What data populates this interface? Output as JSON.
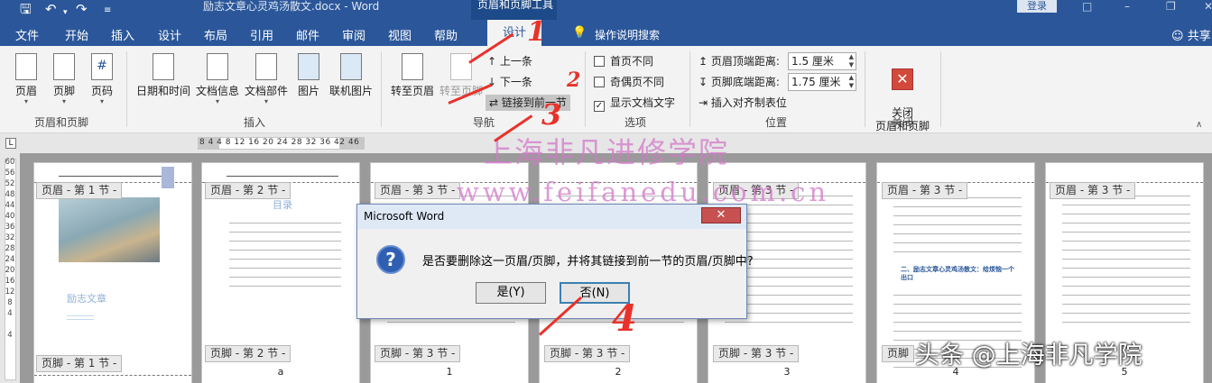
{
  "title_bar": {
    "doc_title": "励志文章心灵鸡汤散文.docx  -  Word",
    "context_group": "页眉和页脚工具",
    "login": "登录",
    "save_icon": "save-icon",
    "undo_icon": "undo-icon",
    "redo_icon": "redo-icon"
  },
  "tabs": [
    "文件",
    "开始",
    "插入",
    "设计",
    "布局",
    "引用",
    "邮件",
    "审阅",
    "视图",
    "帮助"
  ],
  "active_tab": "设计",
  "tell_me": "操作说明搜索",
  "share": "共享",
  "ribbon": {
    "hf_group": {
      "label": "页眉和页脚",
      "header": "页眉",
      "footer": "页脚",
      "page_number": "页码"
    },
    "insert_group": {
      "label": "插入",
      "datetime": "日期和时间",
      "docinfo": "文档信息",
      "quickparts": "文档部件",
      "picture": "图片",
      "online_picture": "联机图片"
    },
    "nav_group": {
      "label": "导航",
      "goto_header": "转至页眉",
      "goto_footer": "转至页脚",
      "prev": "上一条",
      "next": "下一条",
      "link_prev": "链接到前一节"
    },
    "options_group": {
      "label": "选项",
      "diff_first": "首页不同",
      "diff_odd_even": "奇偶页不同",
      "show_doc_text": "显示文档文字"
    },
    "position_group": {
      "label": "位置",
      "header_top_label": "页眉顶端距离:",
      "header_top_value": "1.5 厘米",
      "footer_bottom_label": "页脚底端距离:",
      "footer_bottom_value": "1.75 厘米",
      "insert_align_tab": "插入对齐制表位"
    },
    "close_group": {
      "label": "关闭",
      "close_btn": "关闭\n页眉和页脚"
    }
  },
  "ruler": {
    "corner": "L",
    "h_text": "8 4   4  8 12 16 20 24 28 32 36  42 46",
    "v_text": "60\n56\n52\n48\n44\n40\n36\n32\n28\n24\n20\n16\n12\n8\n4\n\n4"
  },
  "pages": [
    {
      "header": "页眉 - 第 1 节 -",
      "footer": "页脚 - 第 1 节 -",
      "title": "励志文章",
      "num": ""
    },
    {
      "header": "页眉 - 第 2 节 -",
      "footer": "页脚 - 第 2 节 -",
      "title": "目录",
      "num": "a"
    },
    {
      "header": "页眉 - 第 3 节 -",
      "footer": "页脚 - 第 3 节 -",
      "title": "",
      "num": "1"
    },
    {
      "header": "",
      "footer": "页脚 - 第 3 节 -",
      "title": "",
      "num": "2"
    },
    {
      "header": "页眉 - 第 3 节 -",
      "footer": "页脚 - 第 3 节 -",
      "title": "",
      "num": "3"
    },
    {
      "header": "页眉 - 第 3 节 -",
      "footer": "页脚",
      "title": "二、励志文章心灵鸡汤散文：给烦恼一个出口",
      "num": "4"
    },
    {
      "header": "页眉 - 第 3 节 -",
      "footer": "",
      "title": "",
      "num": "5"
    }
  ],
  "watermark": {
    "line1": "上海非凡进修学院",
    "line2": "www.feifanedu.com.cn"
  },
  "dialog": {
    "title": "Microsoft Word",
    "close": "✕",
    "message": "是否要删除这一页眉/页脚，并将其链接到前一节的页眉/页脚中?",
    "yes": "是(Y)",
    "no": "否(N)"
  },
  "annotations": [
    "1",
    "2",
    "3",
    "4"
  ],
  "brand": "头条 @上海非凡学院",
  "colors": {
    "word_blue": "#2b579a",
    "annotation_red": "#e8322b",
    "watermark_pink": "#d278c8"
  }
}
